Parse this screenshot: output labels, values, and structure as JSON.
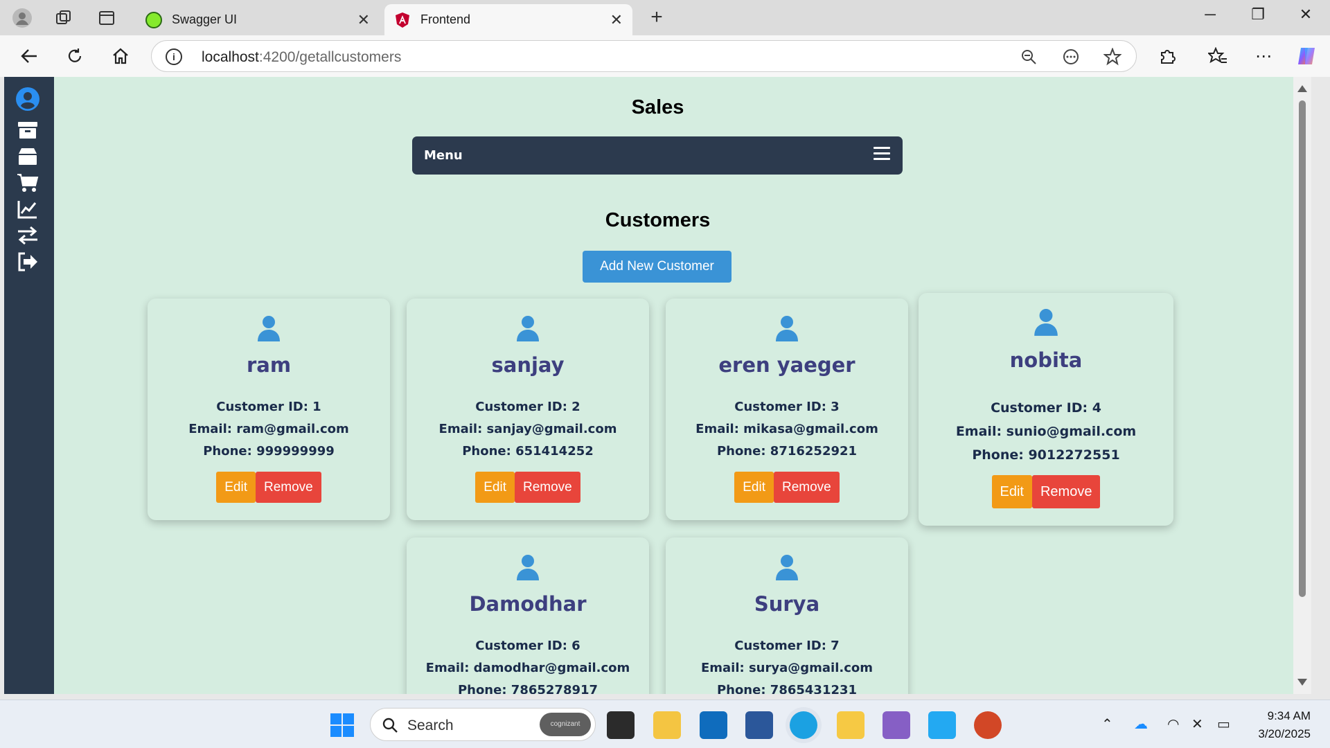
{
  "browser": {
    "tabs": [
      {
        "title": "Swagger UI",
        "active": false,
        "favicon_color": "#85ea2d"
      },
      {
        "title": "Frontend",
        "active": true,
        "favicon_color": "#dd0031"
      }
    ],
    "url_host": "localhost",
    "url_rest": ":4200/getallcustomers"
  },
  "page": {
    "title": "Sales",
    "menu_label": "Menu",
    "section_title": "Customers",
    "add_button": "Add New Customer",
    "sidebar_icons": [
      "user-avatar-icon",
      "archive-icon",
      "box-icon",
      "cart-icon",
      "chart-line-icon",
      "exchange-icon",
      "logout-icon"
    ]
  },
  "customers": [
    {
      "name": "ram",
      "id": "Customer ID: 1",
      "email": "Email: ram@gmail.com",
      "phone": "Phone: 999999999",
      "edit": "Edit",
      "remove": "Remove"
    },
    {
      "name": "sanjay",
      "id": "Customer ID: 2",
      "email": "Email: sanjay@gmail.com",
      "phone": "Phone: 651414252",
      "edit": "Edit",
      "remove": "Remove"
    },
    {
      "name": "eren yaeger",
      "id": "Customer ID: 3",
      "email": "Email: mikasa@gmail.com",
      "phone": "Phone: 8716252921",
      "edit": "Edit",
      "remove": "Remove"
    },
    {
      "name": "nobita",
      "id": "Customer ID: 4",
      "email": "Email: sunio@gmail.com",
      "phone": "Phone: 9012272551",
      "edit": "Edit",
      "remove": "Remove"
    },
    {
      "name": "Damodhar",
      "id": "Customer ID: 6",
      "email": "Email: damodhar@gmail.com",
      "phone": "Phone: 7865278917"
    },
    {
      "name": "Surya",
      "id": "Customer ID: 7",
      "email": "Email: surya@gmail.com",
      "phone": "Phone: 7865431231"
    }
  ],
  "taskbar": {
    "search_label": "Search",
    "search_badge": "cognizant",
    "time": "9:34 AM",
    "date": "3/20/2025"
  },
  "colors": {
    "page_bg": "#d5ede0",
    "sidebar_bg": "#2b3a4d",
    "accent_blue": "#3a93d6",
    "edit_orange": "#f29a16",
    "remove_red": "#e8453b",
    "name_purple": "#3d3f7f"
  }
}
